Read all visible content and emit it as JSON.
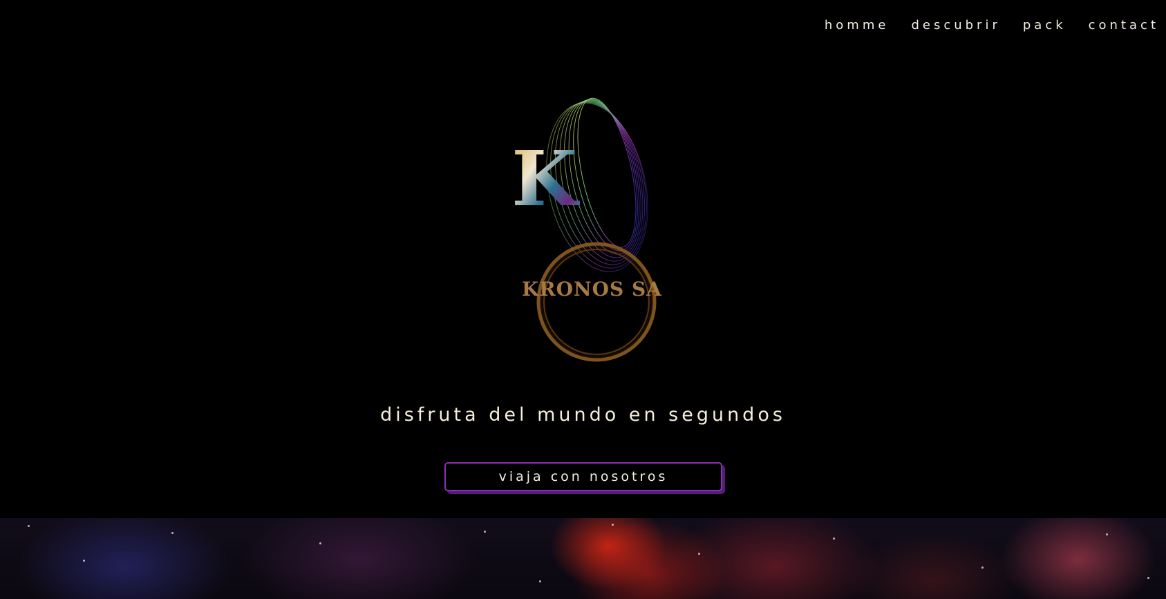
{
  "nav": {
    "items": [
      {
        "label": "Homme"
      },
      {
        "label": "DESCUBRIR"
      },
      {
        "label": "PACK"
      },
      {
        "label": "CONTACT"
      }
    ]
  },
  "logo": {
    "text": "KRONOS SA",
    "colors": {
      "ring": "#9b6a2a",
      "text": "#a77a43"
    }
  },
  "hero": {
    "tagline": "DISFRUTA DEL MUNDO EN SEGUNDOS",
    "cta_label": "VIAJA CON NOSOTROS"
  },
  "colors": {
    "background": "#000000",
    "accent": "#8a2fb3",
    "text": "#f4efe4"
  }
}
